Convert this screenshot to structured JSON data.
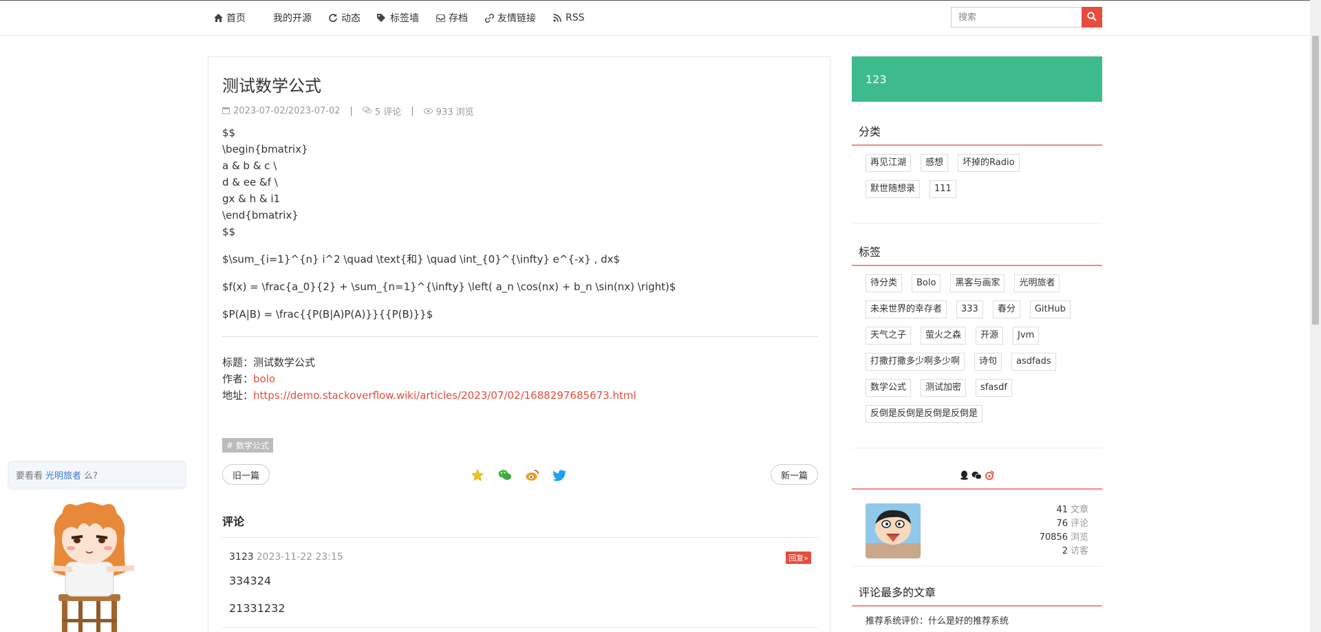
{
  "nav": {
    "items": [
      {
        "label": "首页",
        "icon": "home-icon"
      },
      {
        "label": "我的开源",
        "icon": ""
      },
      {
        "label": "动态",
        "icon": "refresh-icon"
      },
      {
        "label": "标签墙",
        "icon": "tags-icon"
      },
      {
        "label": "存档",
        "icon": "inbox-icon"
      },
      {
        "label": "友情链接",
        "icon": "link-icon"
      },
      {
        "label": "RSS",
        "icon": "rss-icon"
      }
    ],
    "search_placeholder": "搜索"
  },
  "article": {
    "title": "测试数学公式",
    "date": "2023-07-02/2023-07-02",
    "comments": "5 评论",
    "views": "933 浏览",
    "body_block": [
      "$$",
      "\\begin{bmatrix}",
      "a & b & c \\",
      "d & ee &f \\",
      "gx & h & i1",
      "\\end{bmatrix}",
      "$$"
    ],
    "formulas": [
      "$\\sum_{i=1}^{n} i^2 \\quad \\text{和} \\quad \\int_{0}^{\\infty} e^{-x} , dx$",
      "$f(x) = \\frac{a_0}{2} + \\sum_{n=1}^{\\infty} \\left( a_n \\cos(nx) + b_n \\sin(nx) \\right)$",
      "$P(A|B) = \\frac{{P(B|A)P(A)}}{{P(B)}}$"
    ],
    "info": {
      "title_label": "标题：",
      "title_value": "测试数学公式",
      "author_label": "作者：",
      "author_value": "bolo",
      "url_label": "地址：",
      "url_value": "https://demo.stackoverflow.wiki/articles/2023/07/02/1688297685673.html"
    },
    "tag": "# 数学公式",
    "prev_label": "旧一篇",
    "next_label": "新一篇",
    "comments_heading": "评论",
    "comment_list": [
      {
        "user": "3123",
        "time": "2023-11-22 23:15",
        "reply": "回复»",
        "lines": [
          "334324",
          "21331232"
        ]
      }
    ]
  },
  "sidebar": {
    "banner": "123",
    "categories_title": "分类",
    "categories": [
      "再见江湖",
      "感想",
      "坏掉的Radio",
      "默世随想录",
      "111"
    ],
    "tags_title": "标签",
    "tags": [
      "待分类",
      "Bolo",
      "黑客与画家",
      "光明旅者",
      "未来世界的幸存者",
      "333",
      "春分",
      "GitHub",
      "天气之子",
      "萤火之森",
      "开源",
      "Jvm",
      "打撒打撒多少啊多少啊",
      "诗句",
      "asdfads",
      "数学公式",
      "测试加密",
      "sfasdf",
      "反倒是反倒是反倒是反倒是"
    ],
    "stats": [
      {
        "value": "41",
        "label": "文章"
      },
      {
        "value": "76",
        "label": "评论"
      },
      {
        "value": "70856",
        "label": "浏览"
      },
      {
        "value": "2",
        "label": "访客"
      }
    ],
    "most_title": "评论最多的文章",
    "most_items": [
      "推荐系统评价：什么是好的推荐系统"
    ]
  },
  "mascot": {
    "prefix": "要看看",
    "highlight": "光明旅者",
    "suffix": "么?"
  },
  "colors": {
    "accent": "#e74c3c",
    "banner": "#3dbb8c",
    "underline": "#f08a80"
  }
}
